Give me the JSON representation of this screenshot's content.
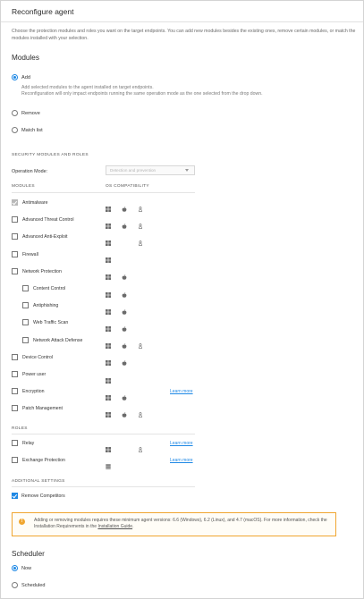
{
  "title": "Reconfigure agent",
  "description": "Choose the protection modules and roles you want on the target endpoints. You can add new modules besides the existing ones, remove certain modules, or match the modules installed with your selection.",
  "modules_section": {
    "title": "Modules",
    "options": [
      {
        "label": "Add",
        "checked": true
      },
      {
        "label": "Remove",
        "checked": false
      },
      {
        "label": "Match list",
        "checked": false
      }
    ],
    "add_note_1": "Add selected modules to the agent installed on target endpoints.",
    "add_note_2": "Reconfiguration will only impact endpoints running the same operation mode as the one selected from the drop down."
  },
  "security_header": "SECURITY MODULES AND ROLES",
  "operation_mode": {
    "label": "Operation Mode:",
    "placeholder": "Detection and prevention"
  },
  "columns": {
    "modules": "MODULES",
    "os": "OS COMPATIBILITY"
  },
  "modules": [
    {
      "label": "Antimalware",
      "state": "disabled-checked",
      "indent": false,
      "os": [
        "windows",
        "apple",
        "linux"
      ],
      "learn": ""
    },
    {
      "label": "Advanced Threat Control",
      "state": "unchecked",
      "indent": false,
      "os": [
        "windows",
        "apple",
        "linux"
      ],
      "learn": ""
    },
    {
      "label": "Advanced Anti-Exploit",
      "state": "unchecked",
      "indent": false,
      "os": [
        "windows",
        "",
        "linux"
      ],
      "learn": ""
    },
    {
      "label": "Firewall",
      "state": "unchecked",
      "indent": false,
      "os": [
        "windows",
        "",
        ""
      ],
      "learn": ""
    },
    {
      "label": "Network Protection",
      "state": "unchecked",
      "indent": false,
      "os": [
        "windows",
        "apple",
        ""
      ],
      "learn": ""
    },
    {
      "label": "Content Control",
      "state": "unchecked",
      "indent": true,
      "os": [
        "windows",
        "apple",
        ""
      ],
      "learn": ""
    },
    {
      "label": "Antiphishing",
      "state": "unchecked",
      "indent": true,
      "os": [
        "windows",
        "apple",
        ""
      ],
      "learn": ""
    },
    {
      "label": "Web Traffic Scan",
      "state": "unchecked",
      "indent": true,
      "os": [
        "windows",
        "apple",
        ""
      ],
      "learn": ""
    },
    {
      "label": "Network Attack Defense",
      "state": "unchecked",
      "indent": true,
      "os": [
        "windows",
        "apple",
        "linux"
      ],
      "learn": ""
    },
    {
      "label": "Device Control",
      "state": "unchecked",
      "indent": false,
      "os": [
        "windows",
        "apple",
        ""
      ],
      "learn": ""
    },
    {
      "label": "Power user",
      "state": "unchecked",
      "indent": false,
      "os": [
        "windows",
        "",
        ""
      ],
      "learn": ""
    },
    {
      "label": "Encryption",
      "state": "unchecked",
      "indent": false,
      "os": [
        "windows",
        "apple",
        ""
      ],
      "learn": "Learn more"
    },
    {
      "label": "Patch Management",
      "state": "unchecked",
      "indent": false,
      "os": [
        "windows",
        "apple",
        "linux"
      ],
      "learn": ""
    }
  ],
  "roles_header": "ROLES",
  "roles": [
    {
      "label": "Relay",
      "state": "unchecked",
      "os": [
        "windows",
        "",
        "linux"
      ],
      "learn": "Learn more"
    },
    {
      "label": "Exchange Protection",
      "state": "unchecked",
      "os": [
        "server",
        "",
        ""
      ],
      "learn": "Learn more"
    }
  ],
  "additional_header": "ADDITIONAL SETTINGS",
  "remove_competitors": {
    "label": "Remove Competitors",
    "checked": true
  },
  "alert": {
    "text_1": "Adding or removing modules requires these minimum agent versions: 6.6 (Windows), 6.2 (Linux), and 4.7 (macOS). For more information, check the Installation Requirements in the ",
    "link": "Installation Guide",
    "text_2": ".",
    "icon": "warning-icon"
  },
  "scheduler": {
    "title": "Scheduler",
    "options": [
      {
        "label": "Now",
        "checked": true
      },
      {
        "label": "Scheduled",
        "checked": false
      }
    ]
  },
  "colors": {
    "accent": "#1e88e5",
    "warning": "#f0a630"
  }
}
